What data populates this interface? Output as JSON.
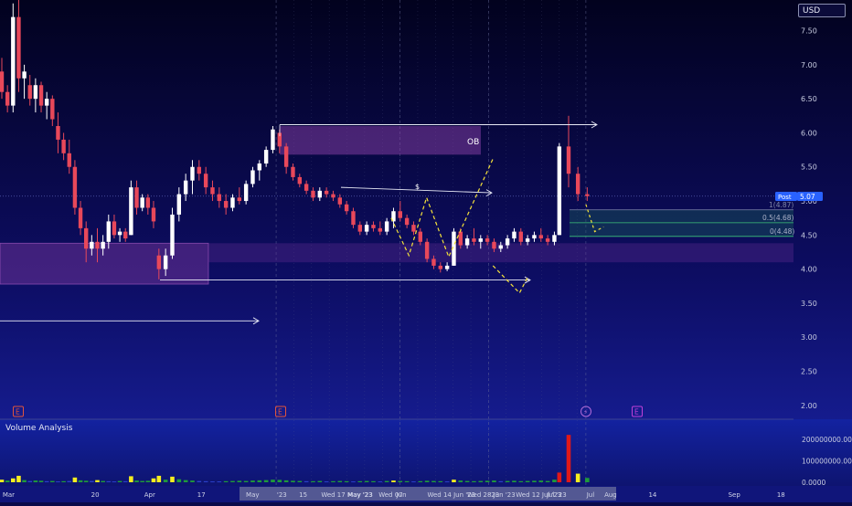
{
  "currency": "USD",
  "volume_panel_label": "Volume Analysis",
  "price_tag": {
    "label": "Post",
    "value": "5.07",
    "color": "#2962ff"
  },
  "annotations": {
    "ob": "OB",
    "dollar": "$",
    "fib_1": "1(4.87)",
    "fib_05": "0.5(4.68)",
    "fib_0": "0(4.48)"
  },
  "event_markers": [
    {
      "label": "E",
      "date_index": 0,
      "color": "#e0543c"
    },
    {
      "label": "E",
      "date_index": 58,
      "color": "#e0543c"
    },
    {
      "label": "⚡",
      "date_index": 127,
      "color": "#b06ad8"
    },
    {
      "label": "E",
      "date_index": 140,
      "color": "#c040d8"
    }
  ],
  "x_tick_labels": [
    {
      "label": "Mar",
      "index": 1
    },
    {
      "label": "20",
      "index": 21
    },
    {
      "label": "Apr",
      "index": 33
    },
    {
      "label": "17",
      "index": 45
    },
    {
      "label": "May",
      "index": 56
    },
    {
      "label": "'23",
      "index": 63
    },
    {
      "label": "15",
      "index": 68
    },
    {
      "label": "Wed 17 May '23",
      "index": 73
    },
    {
      "label": "May '23",
      "index": 79
    },
    {
      "label": "Wed 07",
      "index": 86
    },
    {
      "label": "Jun",
      "index": 90
    },
    {
      "label": "Wed 14 Jun '23",
      "index": 97
    },
    {
      "label": "Wed 28 Jun '23",
      "index": 106
    },
    {
      "label": "'23",
      "index": 111
    },
    {
      "label": "Wed 12 Jul '23",
      "index": 117
    },
    {
      "label": "Jul '23",
      "index": 124
    },
    {
      "label": "Jul",
      "index": 133
    },
    {
      "label": "Aug",
      "index": 137
    },
    {
      "label": "14",
      "index": 147
    },
    {
      "label": "Sep",
      "index": 165
    },
    {
      "label": "18",
      "index": 176
    }
  ],
  "chart_data": {
    "type": "candlestick",
    "y_axis": {
      "ticks": [
        "2.00",
        "2.50",
        "3.00",
        "3.50",
        "4.00",
        "4.50",
        "5.00",
        "5.50",
        "6.00",
        "6.50",
        "7.00",
        "7.50"
      ],
      "ylim": [
        1.85,
        7.95
      ]
    },
    "ohlc": [
      [
        6.9,
        7.1,
        6.5,
        6.6
      ],
      [
        6.6,
        6.7,
        6.3,
        6.4
      ],
      [
        6.4,
        7.9,
        6.3,
        7.7
      ],
      [
        7.7,
        7.95,
        6.6,
        6.8
      ],
      [
        6.8,
        7.0,
        6.5,
        6.9
      ],
      [
        6.7,
        6.85,
        6.4,
        6.5
      ],
      [
        6.5,
        6.8,
        6.3,
        6.7
      ],
      [
        6.7,
        6.75,
        6.3,
        6.4
      ],
      [
        6.4,
        6.6,
        6.2,
        6.5
      ],
      [
        6.5,
        6.55,
        6.1,
        6.2
      ],
      [
        6.1,
        6.3,
        5.7,
        5.9
      ],
      [
        5.9,
        6.0,
        5.6,
        5.7
      ],
      [
        5.7,
        5.9,
        5.4,
        5.5
      ],
      [
        5.5,
        5.6,
        4.8,
        4.9
      ],
      [
        4.9,
        5.0,
        4.5,
        4.6
      ],
      [
        4.6,
        4.7,
        4.1,
        4.3
      ],
      [
        4.3,
        4.5,
        4.2,
        4.4
      ],
      [
        4.4,
        4.6,
        4.1,
        4.3
      ],
      [
        4.3,
        4.5,
        4.2,
        4.4
      ],
      [
        4.4,
        4.8,
        4.3,
        4.7
      ],
      [
        4.7,
        4.8,
        4.45,
        4.5
      ],
      [
        4.5,
        4.6,
        4.4,
        4.55
      ],
      [
        4.55,
        4.6,
        4.4,
        4.45
      ],
      [
        4.5,
        5.3,
        4.5,
        5.2
      ],
      [
        5.2,
        5.3,
        4.8,
        4.9
      ],
      [
        4.9,
        5.1,
        4.85,
        5.05
      ],
      [
        5.05,
        5.1,
        4.8,
        4.9
      ],
      [
        4.9,
        5.0,
        4.6,
        4.7
      ],
      [
        4.2,
        4.3,
        3.85,
        4.0
      ],
      [
        4.0,
        4.3,
        3.9,
        4.2
      ],
      [
        4.2,
        4.9,
        4.15,
        4.8
      ],
      [
        4.8,
        5.2,
        4.7,
        5.1
      ],
      [
        5.1,
        5.4,
        5.0,
        5.3
      ],
      [
        5.3,
        5.6,
        5.1,
        5.5
      ],
      [
        5.5,
        5.6,
        5.3,
        5.4
      ],
      [
        5.4,
        5.5,
        5.1,
        5.2
      ],
      [
        5.2,
        5.3,
        5.0,
        5.1
      ],
      [
        5.1,
        5.2,
        4.9,
        5.0
      ],
      [
        5.0,
        5.1,
        4.8,
        4.9
      ],
      [
        4.9,
        5.1,
        4.85,
        5.05
      ],
      [
        5.05,
        5.2,
        4.95,
        5.0
      ],
      [
        5.0,
        5.3,
        4.95,
        5.25
      ],
      [
        5.25,
        5.5,
        5.2,
        5.45
      ],
      [
        5.45,
        5.6,
        5.3,
        5.55
      ],
      [
        5.55,
        5.8,
        5.5,
        5.75
      ],
      [
        5.75,
        6.1,
        5.7,
        6.05
      ],
      [
        6.0,
        6.05,
        5.7,
        5.8
      ],
      [
        5.8,
        5.85,
        5.4,
        5.5
      ],
      [
        5.5,
        5.55,
        5.3,
        5.35
      ],
      [
        5.35,
        5.4,
        5.2,
        5.25
      ],
      [
        5.25,
        5.3,
        5.1,
        5.15
      ],
      [
        5.15,
        5.2,
        5.0,
        5.05
      ],
      [
        5.05,
        5.2,
        5.0,
        5.15
      ],
      [
        5.15,
        5.2,
        5.05,
        5.1
      ],
      [
        5.1,
        5.15,
        5.0,
        5.05
      ],
      [
        5.05,
        5.1,
        4.9,
        4.95
      ],
      [
        4.95,
        5.0,
        4.8,
        4.85
      ],
      [
        4.85,
        4.9,
        4.6,
        4.65
      ],
      [
        4.65,
        4.7,
        4.5,
        4.55
      ],
      [
        4.55,
        4.7,
        4.5,
        4.65
      ],
      [
        4.65,
        4.7,
        4.55,
        4.6
      ],
      [
        4.6,
        4.7,
        4.5,
        4.55
      ],
      [
        4.55,
        4.75,
        4.5,
        4.7
      ],
      [
        4.7,
        4.9,
        4.6,
        4.85
      ],
      [
        4.85,
        5.0,
        4.7,
        4.75
      ],
      [
        4.75,
        4.8,
        4.6,
        4.65
      ],
      [
        4.65,
        4.7,
        4.5,
        4.55
      ],
      [
        4.55,
        4.6,
        4.35,
        4.4
      ],
      [
        4.4,
        4.45,
        4.1,
        4.15
      ],
      [
        4.15,
        4.2,
        4.0,
        4.05
      ],
      [
        4.05,
        4.1,
        3.95,
        4.0
      ],
      [
        4.0,
        4.1,
        3.97,
        4.05
      ],
      [
        4.05,
        4.6,
        4.05,
        4.55
      ],
      [
        4.55,
        4.6,
        4.3,
        4.35
      ],
      [
        4.35,
        4.5,
        4.3,
        4.45
      ],
      [
        4.45,
        4.6,
        4.35,
        4.4
      ],
      [
        4.4,
        4.5,
        4.3,
        4.45
      ],
      [
        4.45,
        4.5,
        4.35,
        4.4
      ],
      [
        4.4,
        4.45,
        4.25,
        4.3
      ],
      [
        4.3,
        4.4,
        4.25,
        4.35
      ],
      [
        4.35,
        4.5,
        4.3,
        4.45
      ],
      [
        4.45,
        4.6,
        4.4,
        4.55
      ],
      [
        4.55,
        4.6,
        4.35,
        4.4
      ],
      [
        4.4,
        4.5,
        4.35,
        4.45
      ],
      [
        4.45,
        4.55,
        4.4,
        4.5
      ],
      [
        4.5,
        4.6,
        4.4,
        4.45
      ],
      [
        4.45,
        4.5,
        4.35,
        4.4
      ],
      [
        4.4,
        4.55,
        4.35,
        4.5
      ],
      [
        4.5,
        5.85,
        4.5,
        5.8
      ],
      [
        5.8,
        6.25,
        5.2,
        5.4
      ],
      [
        5.4,
        5.5,
        5.0,
        5.1
      ],
      [
        5.1,
        5.2,
        5.0,
        5.07
      ]
    ],
    "volume": {
      "ticks": [
        "200000000.00",
        "100000000.00",
        "0.0000"
      ],
      "ylim": [
        0,
        280000000
      ],
      "values": [
        [
          12,
          "yellow"
        ],
        [
          8,
          "green"
        ],
        [
          18,
          "yellow"
        ],
        [
          30,
          "yellow"
        ],
        [
          10,
          "green"
        ],
        [
          6,
          "blue"
        ],
        [
          8,
          "green"
        ],
        [
          7,
          "green"
        ],
        [
          5,
          "blue"
        ],
        [
          6,
          "green"
        ],
        [
          4,
          "blue"
        ],
        [
          5,
          "green"
        ],
        [
          6,
          "blue"
        ],
        [
          22,
          "yellow"
        ],
        [
          9,
          "green"
        ],
        [
          7,
          "green"
        ],
        [
          6,
          "blue"
        ],
        [
          10,
          "yellow"
        ],
        [
          6,
          "green"
        ],
        [
          5,
          "blue"
        ],
        [
          4,
          "blue"
        ],
        [
          6,
          "green"
        ],
        [
          5,
          "blue"
        ],
        [
          28,
          "yellow"
        ],
        [
          8,
          "green"
        ],
        [
          6,
          "green"
        ],
        [
          7,
          "green"
        ],
        [
          18,
          "yellow"
        ],
        [
          30,
          "yellow"
        ],
        [
          12,
          "green"
        ],
        [
          26,
          "yellow"
        ],
        [
          14,
          "green"
        ],
        [
          10,
          "green"
        ],
        [
          8,
          "green"
        ],
        [
          6,
          "blue"
        ],
        [
          5,
          "blue"
        ],
        [
          4,
          "blue"
        ],
        [
          4,
          "blue"
        ],
        [
          5,
          "green"
        ],
        [
          6,
          "green"
        ],
        [
          7,
          "green"
        ],
        [
          6,
          "green"
        ],
        [
          8,
          "green"
        ],
        [
          9,
          "green"
        ],
        [
          10,
          "green"
        ],
        [
          12,
          "green"
        ],
        [
          11,
          "green"
        ],
        [
          9,
          "green"
        ],
        [
          7,
          "green"
        ],
        [
          6,
          "green"
        ],
        [
          5,
          "blue"
        ],
        [
          5,
          "green"
        ],
        [
          6,
          "green"
        ],
        [
          4,
          "blue"
        ],
        [
          5,
          "green"
        ],
        [
          6,
          "green"
        ],
        [
          5,
          "green"
        ],
        [
          4,
          "blue"
        ],
        [
          5,
          "green"
        ],
        [
          6,
          "green"
        ],
        [
          5,
          "green"
        ],
        [
          4,
          "blue"
        ],
        [
          6,
          "green"
        ],
        [
          8,
          "yellow"
        ],
        [
          6,
          "green"
        ],
        [
          5,
          "green"
        ],
        [
          4,
          "blue"
        ],
        [
          5,
          "green"
        ],
        [
          7,
          "green"
        ],
        [
          6,
          "green"
        ],
        [
          5,
          "green"
        ],
        [
          4,
          "blue"
        ],
        [
          12,
          "yellow"
        ],
        [
          8,
          "green"
        ],
        [
          6,
          "green"
        ],
        [
          5,
          "green"
        ],
        [
          6,
          "green"
        ],
        [
          7,
          "green"
        ],
        [
          8,
          "green"
        ],
        [
          5,
          "blue"
        ],
        [
          6,
          "green"
        ],
        [
          7,
          "green"
        ],
        [
          5,
          "green"
        ],
        [
          6,
          "green"
        ],
        [
          7,
          "green"
        ],
        [
          8,
          "green"
        ],
        [
          6,
          "green"
        ],
        [
          12,
          "green"
        ],
        [
          45,
          "red"
        ],
        [
          220,
          "red"
        ],
        [
          40,
          "yellow"
        ],
        [
          20,
          "green"
        ]
      ]
    }
  }
}
